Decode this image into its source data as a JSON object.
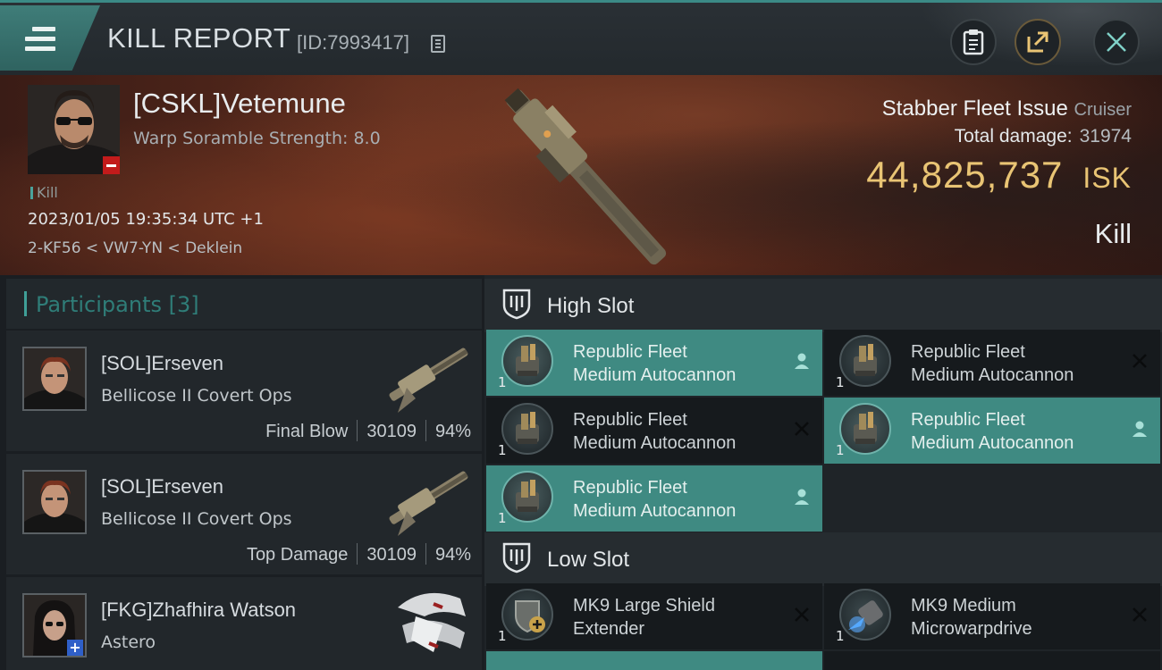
{
  "header": {
    "title": "KILL REPORT",
    "id_label": "[ID:7993417]"
  },
  "victim": {
    "name": "[CSKL]Vetemune",
    "scramble": "Warp Soramble Strength: 8.0",
    "kill_tag": "Kill",
    "datetime": "2023/01/05 19:35:34 UTC +1",
    "location": "2-KF56 < VW7-YN < Deklein",
    "ship_name": "Stabber Fleet Issue",
    "ship_class": "Cruiser",
    "total_damage_label": "Total damage:",
    "total_damage": "31974",
    "isk_value": "44,825,737",
    "isk_unit": "ISK",
    "kill_type": "Kill"
  },
  "participants": {
    "header": "Participants [3]",
    "items": [
      {
        "name": "[SOL]Erseven",
        "ship": "Bellicose II Covert Ops",
        "tag": "Final Blow",
        "damage": "30109",
        "percent": "94%"
      },
      {
        "name": "[SOL]Erseven",
        "ship": "Bellicose II Covert Ops",
        "tag": "Top Damage",
        "damage": "30109",
        "percent": "94%"
      },
      {
        "name": "[FKG]Zhafhira Watson",
        "ship": "Astero",
        "tag": "",
        "damage": "",
        "percent": ""
      }
    ]
  },
  "high_slot": {
    "title": "High Slot",
    "modules": [
      {
        "line1": "Republic Fleet",
        "line2": "Medium Autocannon",
        "qty": "1",
        "state": "fitted"
      },
      {
        "line1": "Republic Fleet",
        "line2": "Medium Autocannon",
        "qty": "1",
        "state": "destroyed"
      },
      {
        "line1": "Republic Fleet",
        "line2": "Medium Autocannon",
        "qty": "1",
        "state": "destroyed"
      },
      {
        "line1": "Republic Fleet",
        "line2": "Medium Autocannon",
        "qty": "1",
        "state": "fitted"
      },
      {
        "line1": "Republic Fleet",
        "line2": "Medium Autocannon",
        "qty": "1",
        "state": "fitted"
      }
    ]
  },
  "low_slot": {
    "title": "Low Slot",
    "modules": [
      {
        "line1": "MK9 Large Shield",
        "line2": "Extender",
        "qty": "1",
        "state": "destroyed"
      },
      {
        "line1": "MK9 Medium",
        "line2": "Microwarpdrive",
        "qty": "1",
        "state": "destroyed"
      }
    ]
  },
  "colors": {
    "accent": "#3f8a82",
    "isk": "#e9c474",
    "minus_badge": "#c21b1b",
    "plus_badge": "#2f5fc8"
  },
  "icons": [
    "menu-icon",
    "copy-icon",
    "clipboard-icon",
    "share-icon",
    "close-icon",
    "shield-slot-icon",
    "person-icon",
    "destroyed-x-icon"
  ]
}
